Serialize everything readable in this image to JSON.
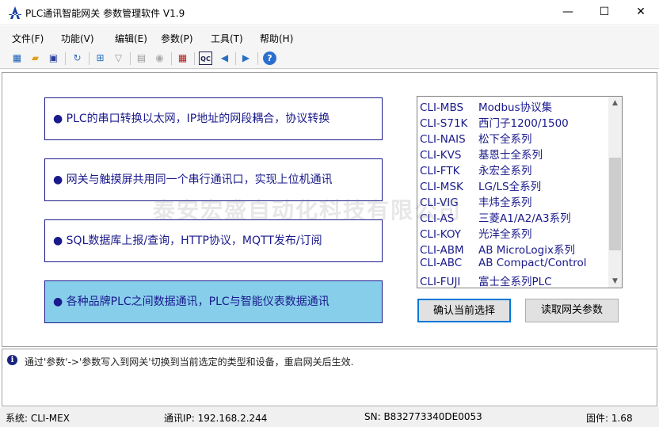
{
  "window": {
    "title": "PLC通讯智能网关 参数管理软件 V1.9",
    "minimize": "—",
    "maximize": "☐",
    "close": "✕"
  },
  "menu": [
    "文件(F)",
    "功能(V)",
    "编辑(E)",
    "参数(P)",
    "工具(T)",
    "帮助(H)"
  ],
  "toolbar": [
    "network-icon",
    "open-folder-icon",
    "save-icon",
    "refresh-icon",
    "topology-icon",
    "connector-icon",
    "window-icon",
    "gauge-icon",
    "grid-icon",
    "qc-icon",
    "prev-icon",
    "next-icon",
    "help-icon"
  ],
  "features": [
    {
      "text": "● PLC的串口转换以太网，IP地址的网段耦合，协议转换",
      "selected": false
    },
    {
      "text": "● 网关与触摸屏共用同一个串行通讯口，实现上位机通讯",
      "selected": false
    },
    {
      "text": "● SQL数据库上报/查询，HTTP协议，MQTT发布/订阅",
      "selected": false
    },
    {
      "text": "● 各种品牌PLC之间数据通讯，PLC与智能仪表数据通讯",
      "selected": true
    }
  ],
  "watermark": "泰安宏盛自动化科技有限公司",
  "devices": [
    {
      "code": "CLI-MBS",
      "desc": "Modbus协议集"
    },
    {
      "code": "CLI-S71K",
      "desc": "西门子1200/1500"
    },
    {
      "code": "CLI-NAIS",
      "desc": "松下全系列"
    },
    {
      "code": "CLI-KVS",
      "desc": "基恩士全系列"
    },
    {
      "code": "CLI-FTK",
      "desc": "永宏全系列"
    },
    {
      "code": "CLI-MSK",
      "desc": "LG/LS全系列"
    },
    {
      "code": "CLI-VIG",
      "desc": "丰炜全系列"
    },
    {
      "code": "CLI-AS",
      "desc": "三菱A1/A2/A3系列"
    },
    {
      "code": "CLI-KOY",
      "desc": "光洋全系列"
    },
    {
      "code": "CLI-ABM",
      "desc": "AB MicroLogix系列"
    },
    {
      "code": "CLI-ABC",
      "desc": "AB Compact/Control"
    },
    {
      "code": "CLI-FUJI",
      "desc": "富士全系列PLC"
    }
  ],
  "buttons": {
    "confirm": "确认当前选择",
    "read": "读取网关参数"
  },
  "message": "通过'参数'->'参数写入到网关'切换到当前选定的类型和设备，重启网关后生效.",
  "status": {
    "system": "系统:  CLI-MEX",
    "ip": "通讯IP:  192.168.2.244",
    "sn": "SN:  B832773340DE0053",
    "firmware": "固件:  1.68"
  }
}
